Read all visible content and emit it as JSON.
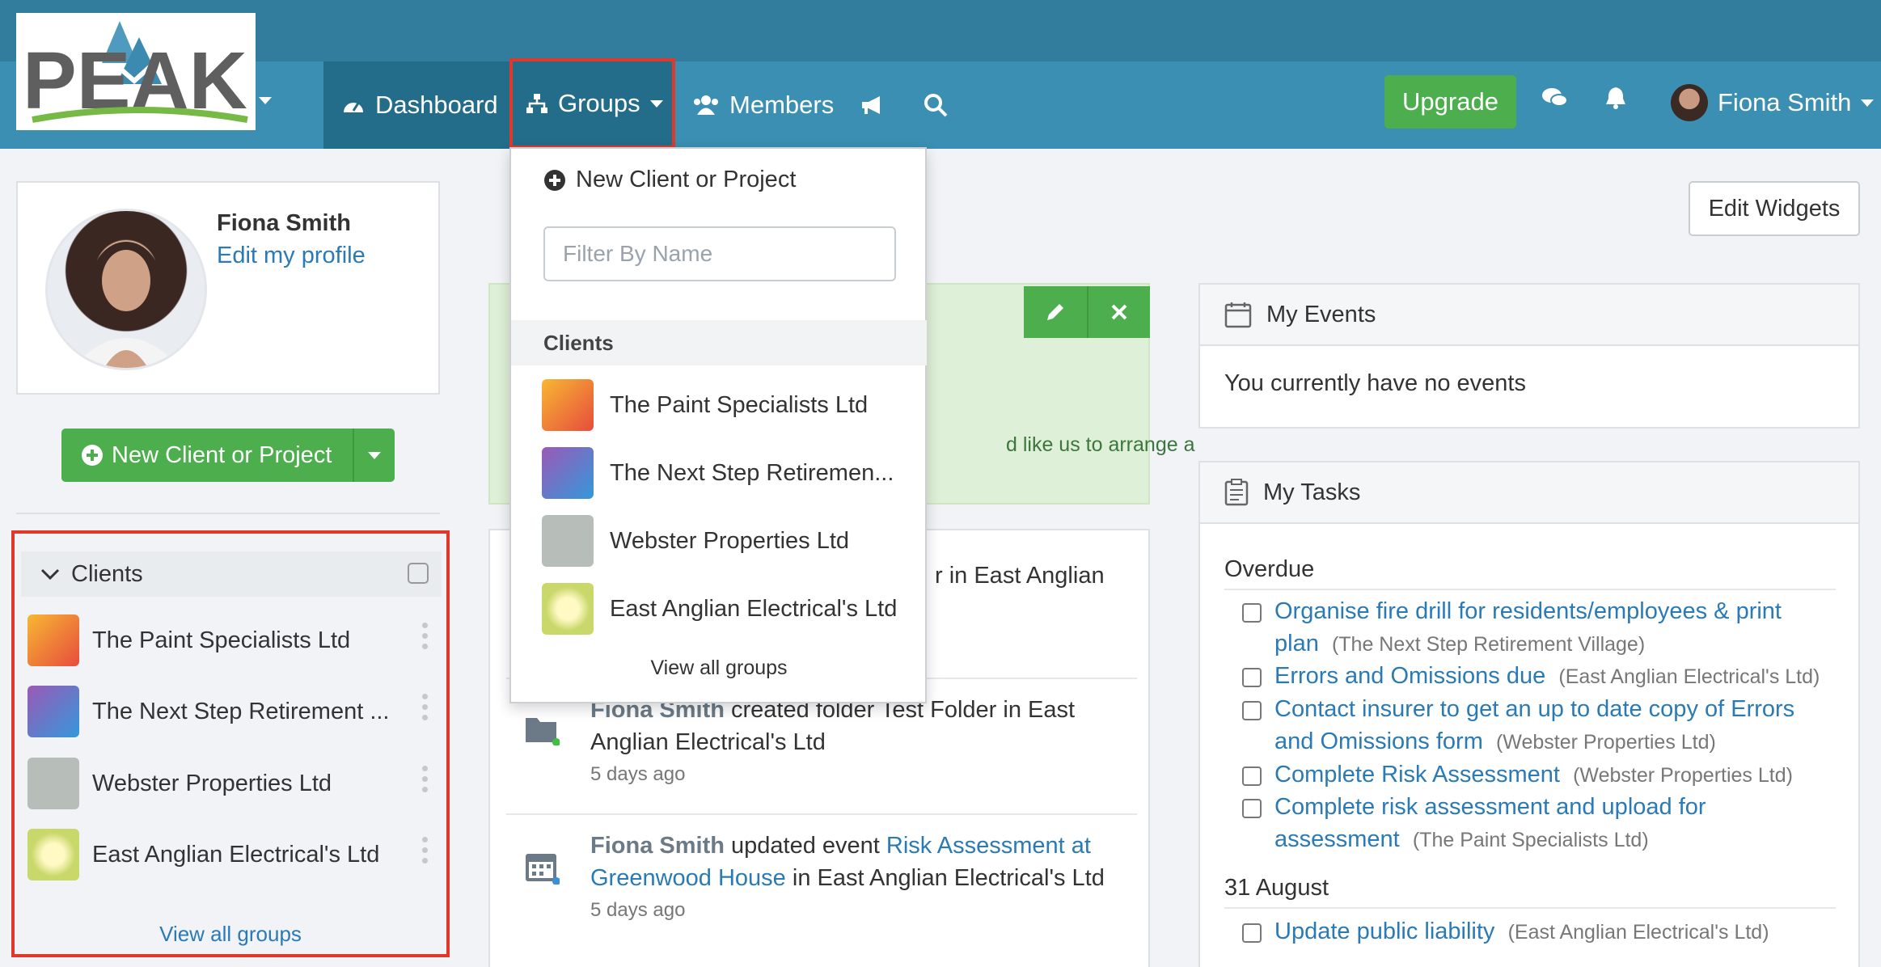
{
  "header": {
    "logo_text": "PEAK",
    "nav": {
      "dashboard": "Dashboard",
      "groups": "Groups",
      "members": "Members"
    },
    "upgrade": "Upgrade",
    "user_name": "Fiona Smith"
  },
  "profile": {
    "name": "Fiona Smith",
    "edit_link": "Edit my profile"
  },
  "left": {
    "new_button": "New Client or Project",
    "clients_title": "Clients",
    "clients": [
      {
        "name": "The Paint Specialists Ltd"
      },
      {
        "name": "The Next Step Retirement ..."
      },
      {
        "name": "Webster Properties Ltd"
      },
      {
        "name": "East Anglian Electrical's Ltd"
      }
    ],
    "view_all": "View all groups"
  },
  "dropdown": {
    "new_item": "New Client or Project",
    "filter_placeholder": "Filter By Name",
    "section": "Clients",
    "items": [
      {
        "name": "The Paint Specialists Ltd"
      },
      {
        "name": "The Next Step Retiremen..."
      },
      {
        "name": "Webster Properties Ltd"
      },
      {
        "name": "East Anglian Electrical's Ltd"
      }
    ],
    "view_all": "View all groups"
  },
  "welcome": {
    "partial_text": "d like us to arrange a"
  },
  "activity": {
    "first_partial": "r in East Anglian",
    "items": [
      {
        "actor": "Fiona Smith",
        "action": " created folder Test Folder in East Anglian Electrical's Ltd",
        "time": "5 days ago"
      },
      {
        "actor": "Fiona Smith",
        "action": " updated event ",
        "link": "Risk Assessment at Greenwood House",
        "suffix": " in East Anglian Electrical's Ltd",
        "time": "5 days ago"
      }
    ]
  },
  "right": {
    "edit_widgets": "Edit Widgets",
    "events_title": "My Events",
    "events_empty": "You currently have no events",
    "tasks_title": "My Tasks",
    "overdue_label": "Overdue",
    "tasks_overdue": [
      {
        "title": "Organise fire drill for residents/employees & print plan",
        "group": "(The Next Step Retirement Village)"
      },
      {
        "title": "Errors and Omissions due",
        "group": "(East Anglian Electrical's Ltd)"
      },
      {
        "title": "Contact insurer to get an up to date copy of Errors and Omissions form",
        "group": "(Webster Properties Ltd)"
      },
      {
        "title": "Complete Risk Assessment",
        "group": "(Webster Properties Ltd)"
      },
      {
        "title": "Complete risk assessment and upload for assessment",
        "group": "(The Paint Specialists Ltd)"
      }
    ],
    "date_label": "31 August",
    "tasks_dated": [
      {
        "title": "Update public liability",
        "group": "(East Anglian Electrical's Ltd)"
      }
    ]
  },
  "colors": {
    "header": "#3a8fb2",
    "nav_active": "#236c8a",
    "green": "#4cae4c",
    "link": "#2a7ab5",
    "highlight": "#e0392b"
  }
}
